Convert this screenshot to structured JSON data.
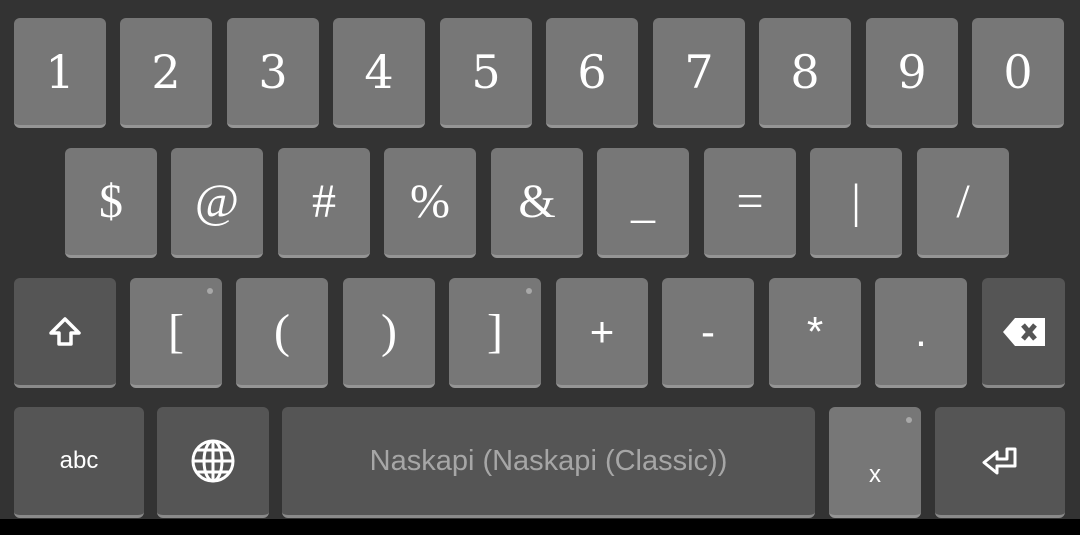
{
  "rows": {
    "numbers": [
      "1",
      "2",
      "3",
      "4",
      "5",
      "6",
      "7",
      "8",
      "9",
      "0"
    ],
    "symbols": [
      "$",
      "@",
      "#",
      "%",
      "&",
      "_",
      "=",
      "|",
      "/"
    ],
    "third": [
      "[",
      "(",
      ")",
      "]",
      "+",
      "-",
      "*",
      "."
    ]
  },
  "bottom": {
    "abc_label": "abc",
    "space_label": "Naskapi (Naskapi (Classic))",
    "x_label": "x"
  },
  "icons": {
    "shift": "shift-icon",
    "backspace": "backspace-icon",
    "globe": "globe-icon",
    "enter": "enter-icon"
  },
  "colors": {
    "background": "#333333",
    "key": "#777777",
    "function_key": "#555555"
  }
}
